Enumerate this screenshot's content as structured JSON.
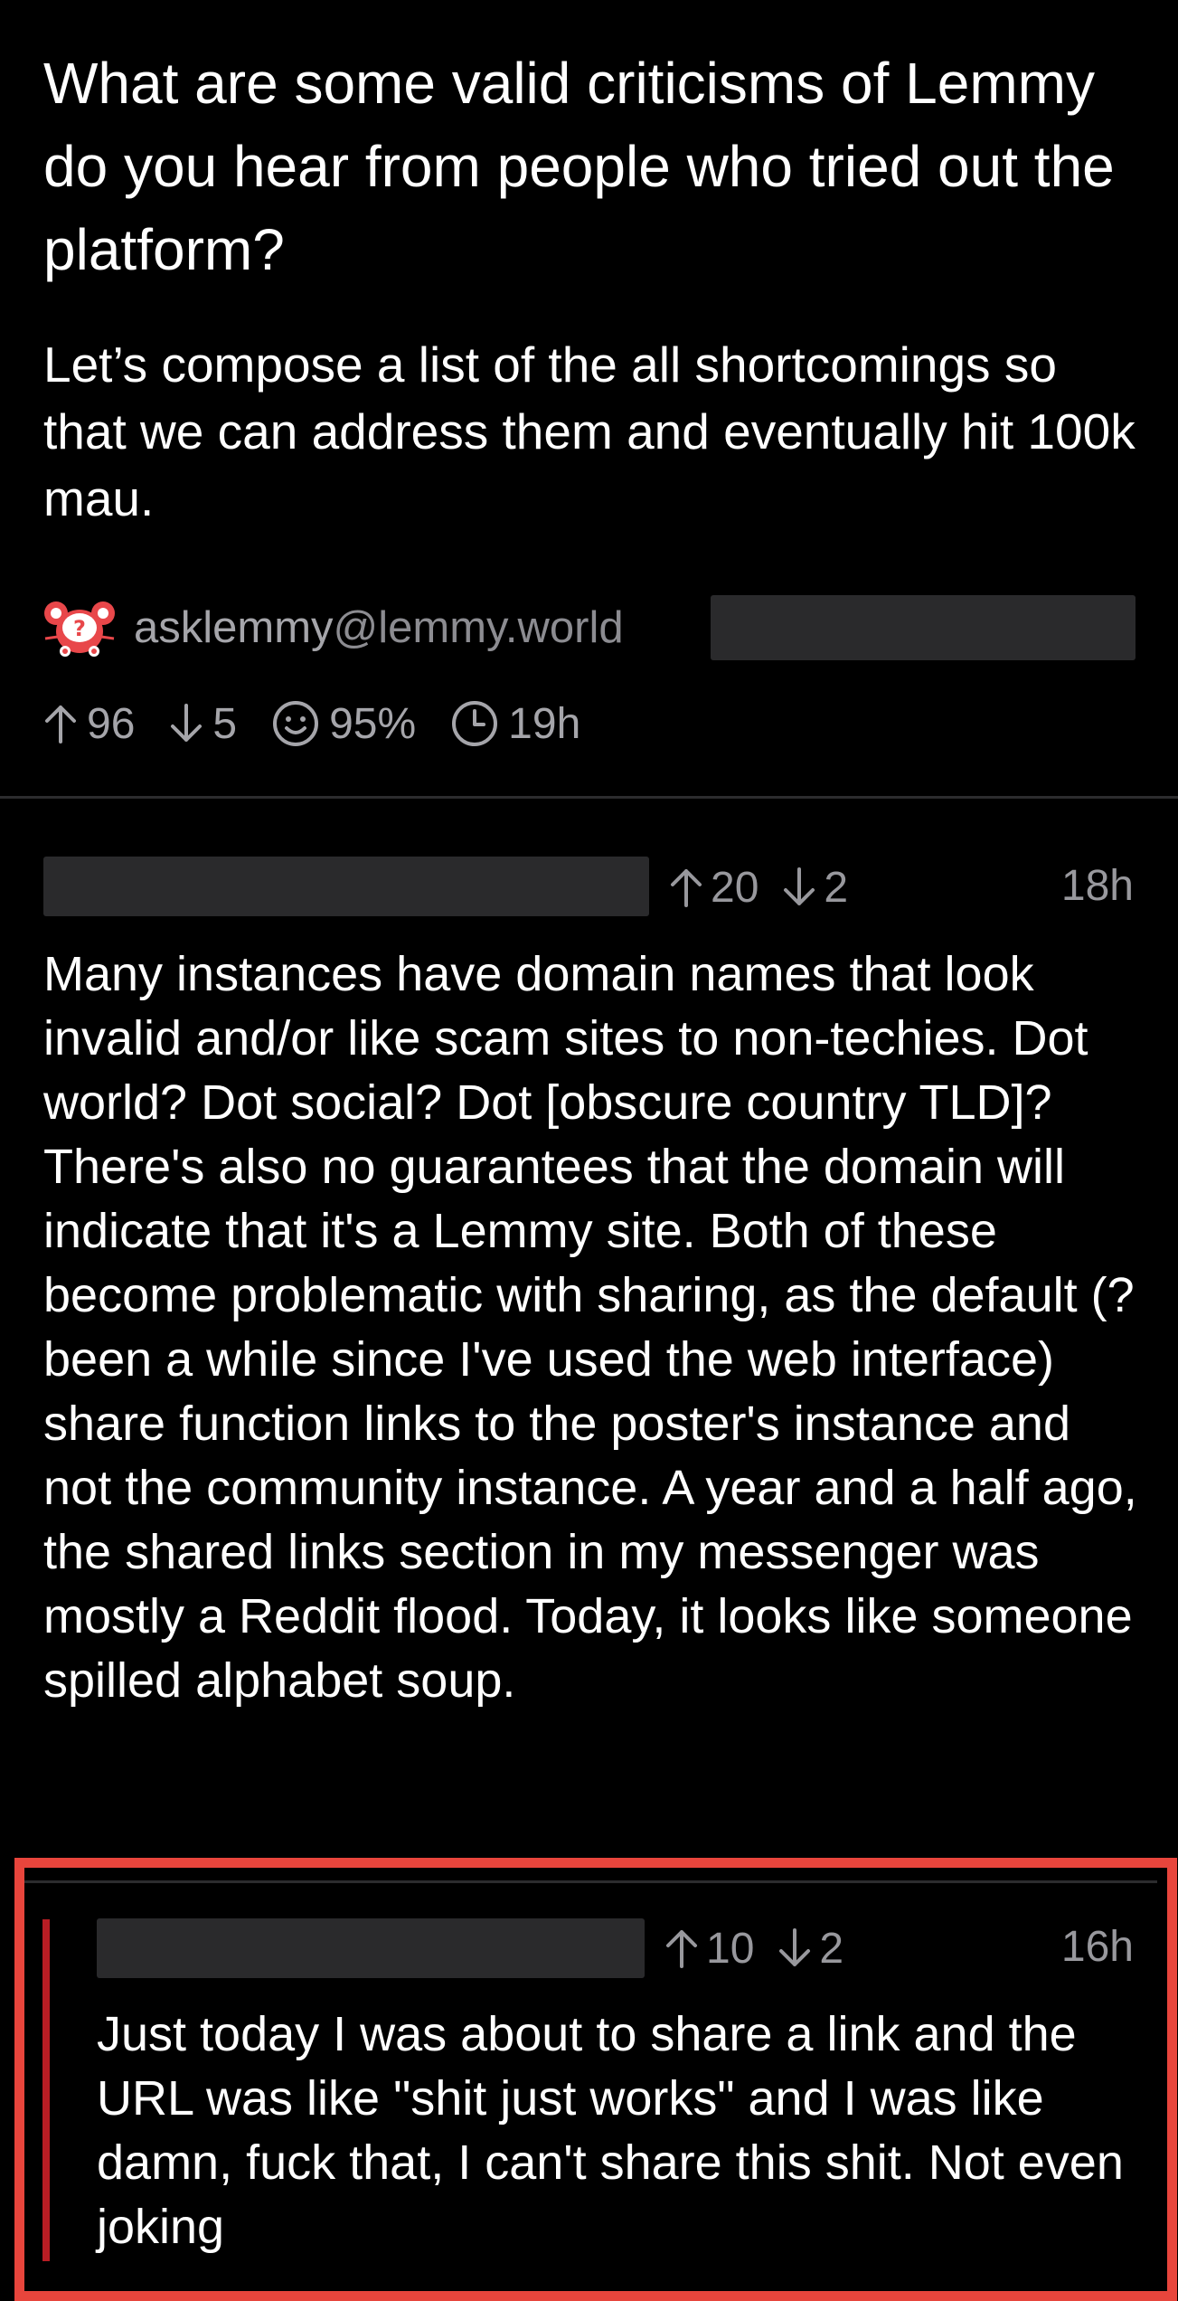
{
  "post": {
    "title": "What are some valid criticisms of Lemmy do you hear from people who tried out the platform?",
    "body": "Let’s compose a list of the all shortcomings so that we can address them and eventually hit 100k mau.",
    "community": {
      "name": "asklemmy",
      "host": "@lemmy.world",
      "avatar_icon": "asklemmy-question-mouse-icon"
    },
    "stats": {
      "upvotes": "96",
      "downvotes": "5",
      "ratio": "95%",
      "age": "19h"
    }
  },
  "comments": [
    {
      "upvotes": "20",
      "downvotes": "2",
      "age": "18h",
      "body": "Many instances have domain names that look invalid and/or like scam sites to non-techies. Dot world? Dot social? Dot [obscure country TLD]? There's also no guarantees that the domain will indicate that it's a Lemmy site. Both of these become problematic with sharing, as the default (? been a while since I've used the web interface) share function links to the poster's instance and not the community instance. A year and a half ago, the shared links section in my messenger was mostly a Reddit flood. Today, it looks like someone spilled alphabet soup."
    },
    {
      "upvotes": "10",
      "downvotes": "2",
      "age": "16h",
      "body": "Just today I was about to share a link and the URL was like \"shit just works\" and I was like damn, fuck that, I can't share this shit. Not even joking"
    }
  ],
  "colors": {
    "background": "#000000",
    "text": "#ffffff",
    "muted": "#98989d",
    "redaction": "#2a2a2c",
    "highlight": "#e8453c",
    "reply_bar": "#b81d24",
    "avatar": "#e8474a"
  }
}
